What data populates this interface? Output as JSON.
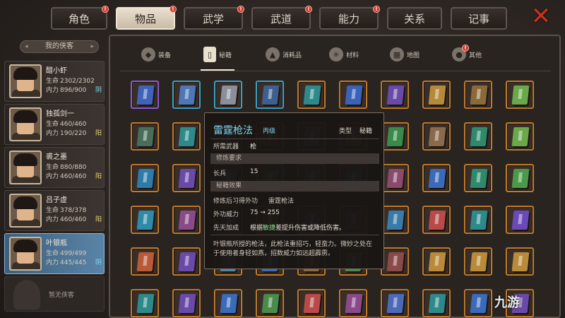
{
  "top_tabs": [
    {
      "label": "角色",
      "badge": true
    },
    {
      "label": "物品",
      "badge": true,
      "active": true
    },
    {
      "label": "武学",
      "badge": true
    },
    {
      "label": "武道",
      "badge": true
    },
    {
      "label": "能力",
      "badge": true
    },
    {
      "label": "关系",
      "badge": false
    },
    {
      "label": "记事",
      "badge": false
    }
  ],
  "badge_glyph": "!",
  "close_glyph": "✕",
  "left": {
    "header": "我的侠客",
    "arrow_left": "◂",
    "arrow_right": "▸",
    "characters": [
      {
        "name": "醋小虾",
        "hp_label": "生命",
        "hp": "2302/2302",
        "mp_label": "内力",
        "mp": "896/900",
        "attr": "阴",
        "attr_color": "#7fd6f2"
      },
      {
        "name": "独孤剑一",
        "hp_label": "生命",
        "hp": "460/460",
        "mp_label": "内力",
        "mp": "190/220",
        "attr": "阳",
        "attr_color": "#e8d76a"
      },
      {
        "name": "裘之墨",
        "hp_label": "生命",
        "hp": "880/880",
        "mp_label": "内力",
        "mp": "460/460",
        "attr": "阳",
        "attr_color": "#e8d76a"
      },
      {
        "name": "吕子虚",
        "hp_label": "生命",
        "hp": "378/378",
        "mp_label": "内力",
        "mp": "460/460",
        "attr": "阳",
        "attr_color": "#e8d76a"
      },
      {
        "name": "叶银瓶",
        "hp_label": "生命",
        "hp": "499/499",
        "mp_label": "内力",
        "mp": "445/445",
        "attr": "阴",
        "attr_color": "#7fd6f2",
        "selected": true
      }
    ],
    "empty_slot": "暂无侠客"
  },
  "sub_tabs": [
    {
      "label": "装备",
      "icon": "armor-icon"
    },
    {
      "label": "秘籍",
      "icon": "scroll-icon",
      "active": true
    },
    {
      "label": "消耗品",
      "icon": "potion-icon"
    },
    {
      "label": "材料",
      "icon": "herb-icon"
    },
    {
      "label": "地图",
      "icon": "map-icon"
    },
    {
      "label": "其他",
      "icon": "bag-icon",
      "badge": true
    }
  ],
  "grid": {
    "rows": [
      [
        "purple",
        "blue",
        "blue",
        "blue",
        "orange",
        "orange",
        "orange",
        "orange",
        "orange",
        "orange"
      ],
      [
        "orange",
        "orange",
        "orange",
        "orange",
        "orange",
        "orange",
        "orange",
        "orange",
        "orange",
        "orange"
      ],
      [
        "orange",
        "orange",
        "orange",
        "orange",
        "orange",
        "orange",
        "orange",
        "orange",
        "orange",
        "orange"
      ],
      [
        "orange",
        "orange",
        "orange",
        "orange",
        "orange",
        "orange",
        "orange",
        "orange",
        "orange",
        "orange"
      ],
      [
        "orange",
        "orange",
        "orange",
        "orange",
        "orange",
        "orange",
        "orange",
        "orange",
        "orange",
        "orange"
      ],
      [
        "orange",
        "orange",
        "orange",
        "orange",
        "orange",
        "orange",
        "orange",
        "orange",
        "orange",
        "orange"
      ]
    ],
    "book_colors": [
      [
        "#3f63b8",
        "#4d77b5",
        "#8a8f99",
        "#3e5f8f",
        "#2e8a8a",
        "#3a62b8",
        "#6a4aa8",
        "#b58a3a",
        "#8a6a3a",
        "#6aa84a"
      ],
      [
        "#4a6d5a",
        "#2e8a8a",
        "#4a4a8a",
        "#8a4a3a",
        "#4a6a8a",
        "#8a6a3a",
        "#3a8a4a",
        "#8a6a4a",
        "#2e8a6a",
        "#6aa84a"
      ],
      [
        "#2e7aa8",
        "#6a4aa8",
        "#4a6da8",
        "#4a8a4a",
        "#6a6a6a",
        "#2e8a8a",
        "#8a4a6a",
        "#3a6ab8",
        "#2e8a6a",
        "#4a9a4a"
      ],
      [
        "#2e8aa8",
        "#8a4a8a",
        "#5a5ab8",
        "#8a6a3a",
        "#5a4aa8",
        "#7a3a6a",
        "#3a7aa8",
        "#b84a4a",
        "#2e8a8a",
        "#6a4ab8"
      ],
      [
        "#b85a3a",
        "#6a4aa8",
        "#4a8aa8",
        "#3a6ab8",
        "#8a6a3a",
        "#4a8a4a",
        "#8a4a4a",
        "#b88a3a",
        "#b88a3a",
        "#b88a3a"
      ],
      [
        "#2e8a8a",
        "#6a4aa8",
        "#3a6ab8",
        "#4a8a4a",
        "#b84a4a",
        "#8a4a8a",
        "#4a6ab8",
        "#2e8a8a",
        "#3a6ab8",
        "#6a4aa8"
      ]
    ]
  },
  "tooltip": {
    "title": "雷霆枪法",
    "grade": "丙级",
    "type_label": "类型",
    "type_value": "秘籍",
    "weapon_label": "所需武器",
    "weapon_value": "枪",
    "req_header": "修炼要求",
    "req_label": "长兵",
    "req_value": "15",
    "effect_header": "秘籍效果",
    "learn_label": "修炼后习得外功",
    "learn_value": "雷霆枪法",
    "power_label": "外功威力",
    "power_value": "75 → 255",
    "bonus_label": "先天加成",
    "bonus_pre": "根据",
    "bonus_hl": "敏捷",
    "bonus_post": "差提升伤害或降低伤害。",
    "desc": "叶银瓶所授的枪法，此枪法重招巧，轻蛮力。微妙之处在于使用者身轻如燕，招数威力如远超霹雳。"
  },
  "watermark": "九游"
}
